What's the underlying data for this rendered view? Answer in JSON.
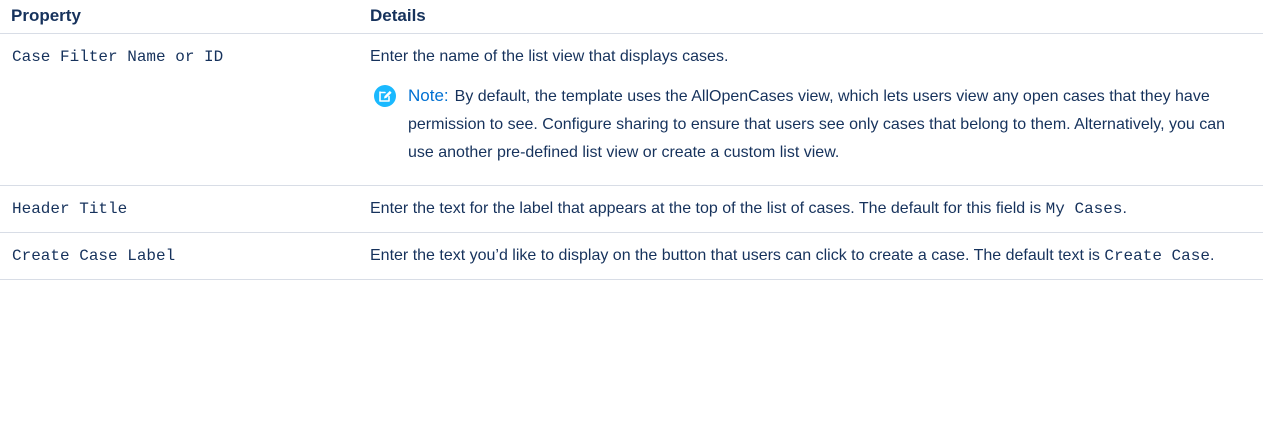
{
  "table": {
    "headers": {
      "property": "Property",
      "details": "Details"
    },
    "rows": [
      {
        "property": "Case Filter Name or ID",
        "details_text": "Enter the name of the list view that displays cases.",
        "note": {
          "icon": "edit-note-icon",
          "label": "Note:",
          "text": "By default, the template uses the AllOpenCases view, which lets users view any open cases that they have permission to see. Configure sharing to ensure that users see only cases that belong to them. Alternatively, you can use another pre-defined list view or create a custom list view."
        }
      },
      {
        "property": "Header Title",
        "details_prefix": "Enter the text for the label that appears at the top of the list of cases. The default for this field is ",
        "details_code": "My Cases",
        "details_suffix": "."
      },
      {
        "property": "Create Case Label",
        "details_prefix": "Enter the text you’d like to display on the button that users can click to create a case. The default text is ",
        "details_code": "Create Case",
        "details_suffix": "."
      }
    ]
  },
  "colors": {
    "text": "#16325c",
    "note_label": "#0070d2",
    "note_icon": "#1ab9ff",
    "border": "#d8dde6"
  }
}
